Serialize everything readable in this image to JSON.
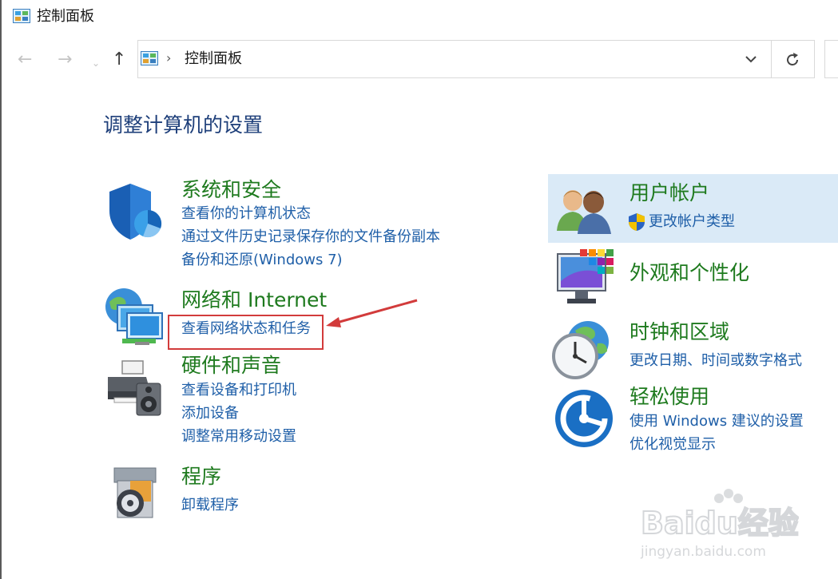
{
  "window": {
    "title": "控制面板"
  },
  "address": {
    "path": "控制面板"
  },
  "page": {
    "heading": "调整计算机的设置"
  },
  "categories_left": [
    {
      "title": "系统和安全",
      "links": [
        "查看你的计算机状态",
        "通过文件历史记录保存你的文件备份副本",
        "备份和还原(Windows 7)"
      ]
    },
    {
      "title": "网络和 Internet",
      "links": [
        "查看网络状态和任务"
      ]
    },
    {
      "title": "硬件和声音",
      "links": [
        "查看设备和打印机",
        "添加设备",
        "调整常用移动设置"
      ]
    },
    {
      "title": "程序",
      "links": [
        "卸载程序"
      ]
    }
  ],
  "categories_right": [
    {
      "title": "用户帐户",
      "links": [
        "更改帐户类型"
      ]
    },
    {
      "title": "外观和个性化",
      "links": []
    },
    {
      "title": "时钟和区域",
      "links": [
        "更改日期、时间或数字格式"
      ]
    },
    {
      "title": "轻松使用",
      "links": [
        "使用 Windows 建议的设置",
        "优化视觉显示"
      ]
    }
  ],
  "watermark": {
    "brand": "Baidu经验",
    "url": "jingyan.baidu.com"
  },
  "colors": {
    "heading": "#1e3f7a",
    "category_title": "#1e7a1e",
    "link": "#1f5fa8",
    "highlight": "#daeaf7",
    "annotation": "#d23b3b"
  }
}
